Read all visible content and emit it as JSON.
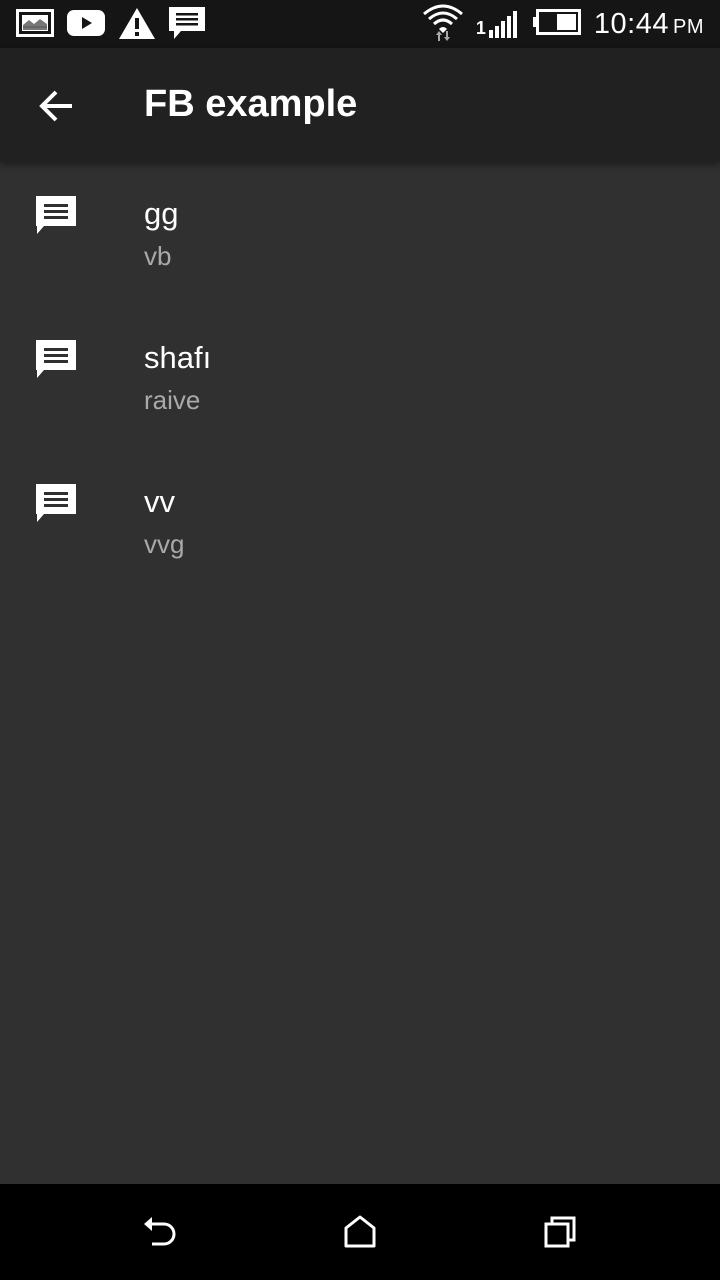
{
  "status_bar": {
    "time": "10:44",
    "ampm": "PM",
    "signal_slot": "1",
    "notification_icons": [
      "image-icon",
      "youtube-icon",
      "warning-icon",
      "message-icon"
    ],
    "system_icons": [
      "wifi-icon",
      "signal-icon",
      "battery-icon"
    ]
  },
  "toolbar": {
    "title": "FB example",
    "back_icon": "arrow-back-icon"
  },
  "list": [
    {
      "primary": "gg",
      "secondary": "vb",
      "icon": "message-icon"
    },
    {
      "primary": "shafı",
      "secondary": "raive",
      "icon": "message-icon"
    },
    {
      "primary": "vv",
      "secondary": "vvg",
      "icon": "message-icon"
    }
  ],
  "nav_bar": {
    "buttons": [
      "back-icon",
      "home-icon",
      "recents-icon"
    ]
  },
  "colors": {
    "background": "#303030",
    "toolbar": "#212121",
    "status_bar": "#151515",
    "nav_bar": "#000000",
    "secondary_text": "#a9a9a9"
  }
}
